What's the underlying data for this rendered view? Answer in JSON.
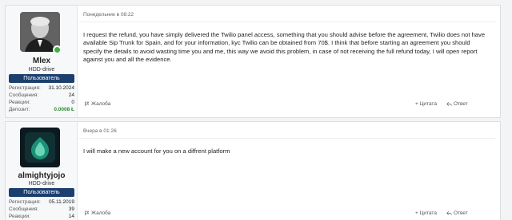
{
  "posts": [
    {
      "username": "Mlex",
      "user_title": "HDD-drive",
      "role_badge": "Пользователь",
      "stats": [
        {
          "label": "Регистрация:",
          "value": "31.10.2024"
        },
        {
          "label": "Сообщения:",
          "value": "24"
        },
        {
          "label": "Реакции:",
          "value": "0"
        },
        {
          "label": "Депозит:",
          "value": "0.0008 Ł"
        }
      ],
      "date": "Понедельник в 08:22",
      "message": "I request the refund, you have simply delivered the Twilio panel access, something that you should advise before the agreement, Twilio does not have available Sip Trunk for Spain, and for your information, kyc Twilio can be obtained from 70$. I think that before starting an agreement you should specify the details to avoid wasting time you and me, this way we avoid this problem, in case of not receiving the full refund today, I will open report against you and all the evidence.",
      "report_label": "Жалоба",
      "quote_label": "+ Цитата",
      "reply_label": "Ответ",
      "online_status_color": "#3cb043"
    },
    {
      "username": "almightyjojo",
      "user_title": "HDD-drive",
      "role_badge": "Пользователь",
      "stats": [
        {
          "label": "Регистрация:",
          "value": "05.11.2019"
        },
        {
          "label": "Сообщения:",
          "value": "39"
        },
        {
          "label": "Реакции:",
          "value": "14"
        }
      ],
      "date": "Вчера в 01:26",
      "message": "I will make a new account for you on a diffrent platform",
      "report_label": "Жалоба",
      "quote_label": "+ Цитата",
      "reply_label": "Ответ"
    }
  ],
  "colors": {
    "badge_bg": "#1c3f6e",
    "deposit_value": "#2e8b2e",
    "page_bg": "#f3f4f6"
  }
}
